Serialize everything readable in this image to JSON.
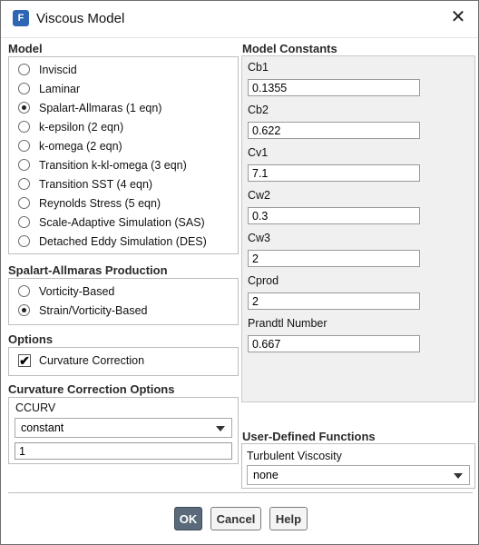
{
  "window": {
    "title": "Viscous Model",
    "app_icon_letter": "F",
    "close_glyph": "✕"
  },
  "model": {
    "title": "Model",
    "options": [
      {
        "label": "Inviscid",
        "checked": false
      },
      {
        "label": "Laminar",
        "checked": false
      },
      {
        "label": "Spalart-Allmaras (1 eqn)",
        "checked": true
      },
      {
        "label": "k-epsilon (2 eqn)",
        "checked": false
      },
      {
        "label": "k-omega (2 eqn)",
        "checked": false
      },
      {
        "label": "Transition k-kl-omega (3 eqn)",
        "checked": false
      },
      {
        "label": "Transition SST (4 eqn)",
        "checked": false
      },
      {
        "label": "Reynolds Stress (5 eqn)",
        "checked": false
      },
      {
        "label": "Scale-Adaptive Simulation (SAS)",
        "checked": false
      },
      {
        "label": "Detached Eddy Simulation (DES)",
        "checked": false
      }
    ]
  },
  "production": {
    "title": "Spalart-Allmaras Production",
    "options": [
      {
        "label": "Vorticity-Based",
        "checked": false
      },
      {
        "label": "Strain/Vorticity-Based",
        "checked": true
      }
    ]
  },
  "options": {
    "title": "Options",
    "curvature_label": "Curvature Correction",
    "curvature_checked": true,
    "check_glyph": "✔"
  },
  "curvature_options": {
    "title": "Curvature Correction Options",
    "ccurv_label": "CCURV",
    "ccurv_value": "constant",
    "ccurv_input": "1"
  },
  "constants": {
    "title": "Model Constants",
    "fields": [
      {
        "label": "Cb1",
        "value": "0.1355"
      },
      {
        "label": "Cb2",
        "value": "0.622"
      },
      {
        "label": "Cv1",
        "value": "7.1"
      },
      {
        "label": "Cw2",
        "value": "0.3"
      },
      {
        "label": "Cw3",
        "value": "2"
      },
      {
        "label": "Cprod",
        "value": "2"
      },
      {
        "label": "Prandtl Number",
        "value": "0.667"
      }
    ]
  },
  "udf": {
    "title": "User-Defined Functions",
    "turbulent_viscosity_label": "Turbulent Viscosity",
    "turbulent_viscosity_value": "none"
  },
  "buttons": {
    "ok": "OK",
    "cancel": "Cancel",
    "help": "Help"
  }
}
